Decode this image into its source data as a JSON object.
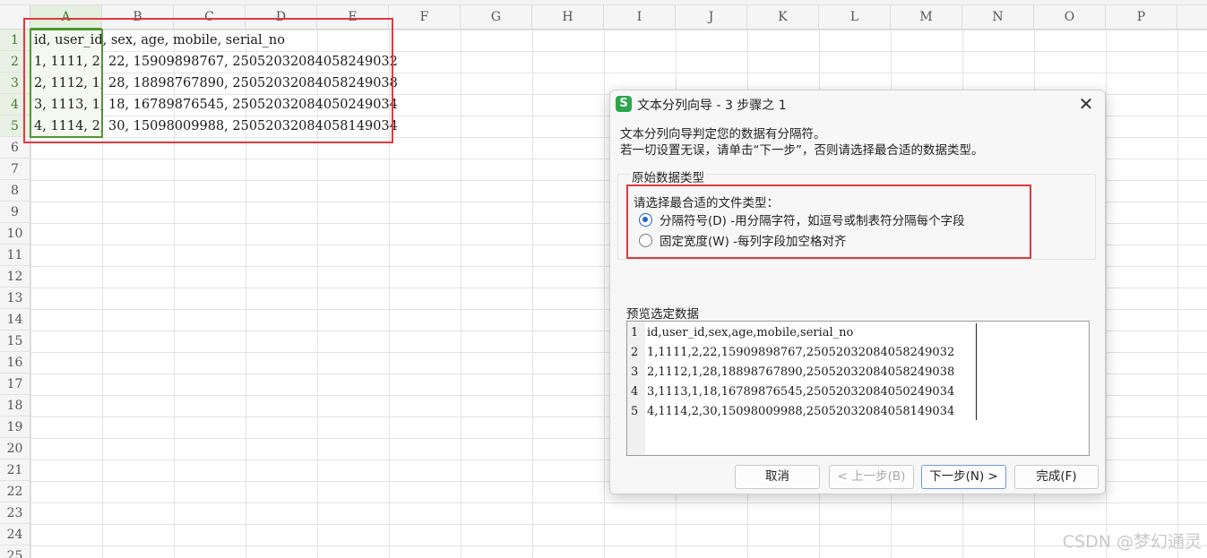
{
  "sheet": {
    "columns": [
      "A",
      "B",
      "C",
      "D",
      "E",
      "F",
      "G",
      "H",
      "I",
      "J",
      "K",
      "L",
      "M",
      "N",
      "O",
      "P"
    ],
    "active_column": "A",
    "row_numbers": [
      "1",
      "2",
      "3",
      "4",
      "5",
      "6",
      "7",
      "8",
      "9",
      "10",
      "11",
      "12",
      "13",
      "14",
      "15",
      "16",
      "17",
      "18",
      "19",
      "20",
      "21",
      "22",
      "23",
      "24",
      "25"
    ],
    "rows": [
      "id, user_id, sex, age, mobile, serial_no",
      "1, 1111, 2, 22, 15909898767, 25052032084058249032",
      "2, 1112, 1, 28, 18898767890, 25052032084058249038",
      "3, 1113, 1, 18, 16789876545, 25052032084050249034",
      "4, 1114, 2, 30, 15098009988, 25052032084058149034"
    ]
  },
  "dialog": {
    "title": "文本分列向导 - 3 步骤之 1",
    "app_icon_letter": "S",
    "close_icon": "close-icon",
    "intro_line1": "文本分列向导判定您的数据有分隔符。",
    "intro_line2": "若一切设置无误，请单击“下一步”，否则请选择最合适的数据类型。",
    "group_title": "原始数据类型",
    "choose_label": "请选择最合适的文件类型：",
    "options": [
      {
        "label": "分隔符号(D)  -用分隔字符，如逗号或制表符分隔每个字段",
        "checked": true
      },
      {
        "label": "固定宽度(W)  -每列字段加空格对齐",
        "checked": false
      }
    ],
    "preview_title": "预览选定数据",
    "preview_lines": [
      {
        "num": "1",
        "text": "id,user_id,sex,age,mobile,serial_no"
      },
      {
        "num": "2",
        "text": "1,1111,2,22,15909898767,25052032084058249032"
      },
      {
        "num": "3",
        "text": "2,1112,1,28,18898767890,25052032084058249038"
      },
      {
        "num": "4",
        "text": "3,1113,1,18,16789876545,25052032084050249034"
      },
      {
        "num": "5",
        "text": "4,1114,2,30,15098009988,25052032084058149034"
      }
    ],
    "buttons": {
      "cancel": "取消",
      "prev": "< 上一步(B)",
      "next": "下一步(N) >",
      "finish": "完成(F)"
    }
  },
  "watermark": "CSDN @梦幻通灵",
  "colors": {
    "highlight_red": "#e0393e",
    "selection_green": "#4c9a2f",
    "radio_blue": "#1a66d2"
  }
}
